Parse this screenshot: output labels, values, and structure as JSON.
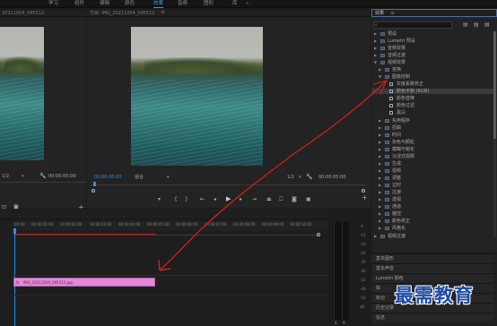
{
  "menu": {
    "items": [
      {
        "label": "学习",
        "active": false
      },
      {
        "label": "组件",
        "active": false
      },
      {
        "label": "编辑",
        "active": false
      },
      {
        "label": "颜色",
        "active": false
      },
      {
        "label": "效果",
        "active": true
      },
      {
        "label": "音频",
        "active": false
      },
      {
        "label": "图形",
        "active": false
      },
      {
        "label": "库",
        "active": false
      }
    ],
    "more": "»"
  },
  "source_monitor": {
    "title": "20211004_095512",
    "zoom": "1/2",
    "timecode": "00:00:05:00"
  },
  "program_monitor": {
    "title": "节目: IMG_20211004_095512",
    "timecode_current": "00:00:00:00",
    "fit": "适合",
    "quality": "1/2",
    "timecode_duration": "00:00:05:00"
  },
  "effects_panel": {
    "title": "效果",
    "tree": [
      {
        "label": "预设",
        "level": 0,
        "type": "folder",
        "open": false,
        "selected": false
      },
      {
        "label": "Lumetri 预设",
        "level": 0,
        "type": "folder",
        "open": false,
        "selected": false
      },
      {
        "label": "音频效果",
        "level": 0,
        "type": "folder",
        "open": false,
        "selected": false
      },
      {
        "label": "音频过渡",
        "level": 0,
        "type": "folder",
        "open": false,
        "selected": false
      },
      {
        "label": "视频效果",
        "level": 0,
        "type": "folder",
        "open": true,
        "selected": false
      },
      {
        "label": "变换",
        "level": 1,
        "type": "folder",
        "open": false,
        "selected": false
      },
      {
        "label": "图像控制",
        "level": 1,
        "type": "folder",
        "open": true,
        "selected": false
      },
      {
        "label": "灰度系数校正",
        "level": 2,
        "type": "effect",
        "open": false,
        "selected": false
      },
      {
        "label": "颜色平衡 (RGB)",
        "level": 2,
        "type": "effect",
        "open": false,
        "selected": true
      },
      {
        "label": "颜色替换",
        "level": 2,
        "type": "effect",
        "open": false,
        "selected": false
      },
      {
        "label": "颜色过滤",
        "level": 2,
        "type": "effect",
        "open": false,
        "selected": false
      },
      {
        "label": "黑白",
        "level": 2,
        "type": "effect",
        "open": false,
        "selected": false
      },
      {
        "label": "实用程序",
        "level": 1,
        "type": "folder",
        "open": false,
        "selected": false
      },
      {
        "label": "扭曲",
        "level": 1,
        "type": "folder",
        "open": false,
        "selected": false
      },
      {
        "label": "时间",
        "level": 1,
        "type": "folder",
        "open": false,
        "selected": false
      },
      {
        "label": "杂色与颗粒",
        "level": 1,
        "type": "folder",
        "open": false,
        "selected": false
      },
      {
        "label": "模糊与锐化",
        "level": 1,
        "type": "folder",
        "open": false,
        "selected": false
      },
      {
        "label": "沉浸式视频",
        "level": 1,
        "type": "folder",
        "open": false,
        "selected": false
      },
      {
        "label": "生成",
        "level": 1,
        "type": "folder",
        "open": false,
        "selected": false
      },
      {
        "label": "视频",
        "level": 1,
        "type": "folder",
        "open": false,
        "selected": false
      },
      {
        "label": "调整",
        "level": 1,
        "type": "folder",
        "open": false,
        "selected": false
      },
      {
        "label": "过时",
        "level": 1,
        "type": "folder",
        "open": false,
        "selected": false
      },
      {
        "label": "过渡",
        "level": 1,
        "type": "folder",
        "open": false,
        "selected": false
      },
      {
        "label": "透视",
        "level": 1,
        "type": "folder",
        "open": false,
        "selected": false
      },
      {
        "label": "通道",
        "level": 1,
        "type": "folder",
        "open": false,
        "selected": false
      },
      {
        "label": "键控",
        "level": 1,
        "type": "folder",
        "open": false,
        "selected": false
      },
      {
        "label": "颜色校正",
        "level": 1,
        "type": "folder",
        "open": false,
        "selected": false
      },
      {
        "label": "风格化",
        "level": 1,
        "type": "folder",
        "open": false,
        "selected": false
      },
      {
        "label": "视频过渡",
        "level": 0,
        "type": "folder",
        "open": false,
        "selected": false
      }
    ],
    "lower_panels": [
      "基本图形",
      "基本声音",
      "Lumetri 颜色",
      "库",
      "标记",
      "历史记录",
      "信息"
    ]
  },
  "timeline": {
    "ticks": [
      "00:00",
      "00:00:01:00",
      "00:00:02:00",
      "00:00:03:00",
      "00:00:04:00",
      "00:00:05:00",
      "00:00:06:00",
      "00:00:07:00",
      "00:00:08:00",
      "00:00:09:00",
      "00:00:10:00",
      "00:00:11:00",
      "00:00:12:00"
    ],
    "clip": {
      "fx_label": "fx",
      "name": "IMG_20211004_095512.jpg",
      "color": "#e08ad8"
    }
  },
  "audio_meter": {
    "scale": [
      "-6",
      "-12",
      "-18",
      "-24",
      "-30",
      "-36",
      "-42",
      "-48",
      "-54",
      "dB"
    ],
    "solo": "S",
    "solo2": "S"
  },
  "watermark": "最需教育",
  "colors": {
    "accent_blue": "#2d8ceb",
    "selection_red": "#d21e1e",
    "clip_pink": "#e08ad8"
  }
}
